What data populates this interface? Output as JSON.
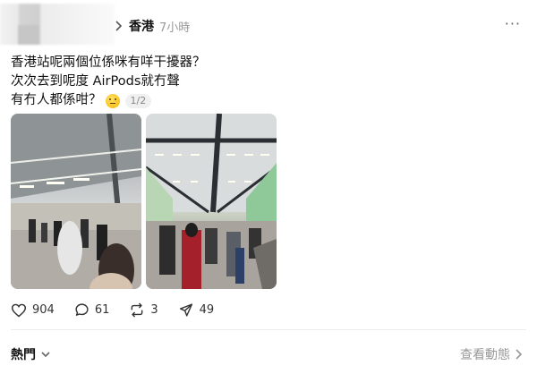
{
  "post": {
    "username": "香港",
    "time": "7小時",
    "text_lines": [
      "香港站呢兩個位係咪有咩干擾器？",
      "次次去到呢度 AirPods就冇聲",
      "有冇人都係咁？"
    ],
    "image_counter": "1/2"
  },
  "actions": {
    "likes": "904",
    "comments": "61",
    "reposts": "3",
    "shares": "49"
  },
  "footer": {
    "section": "熱門",
    "view_label": "查看動態"
  },
  "icons": {
    "more": "more-icon",
    "like": "heart-icon",
    "comment": "comment-icon",
    "repost": "repost-icon",
    "share": "send-icon"
  }
}
